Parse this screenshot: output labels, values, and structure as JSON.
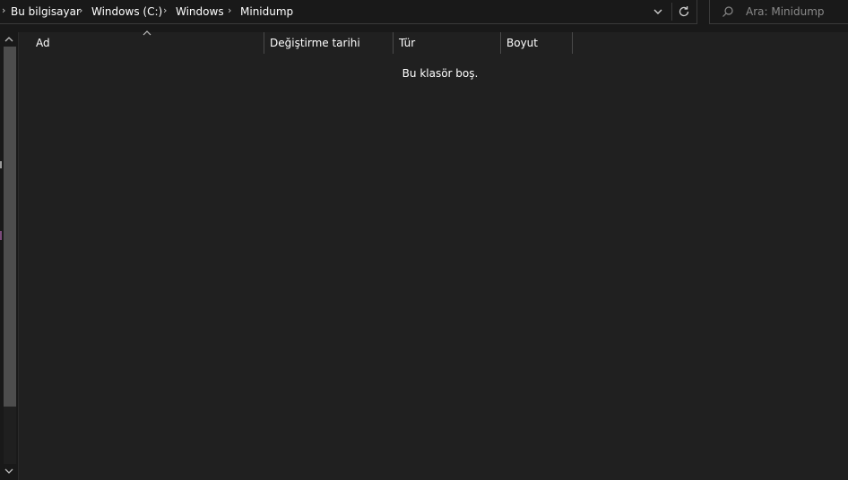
{
  "breadcrumb": {
    "items": [
      {
        "label": "Bu bilgisayar"
      },
      {
        "label": "Windows (C:)"
      },
      {
        "label": "Windows"
      },
      {
        "label": "Minidump"
      }
    ],
    "dropdown_icon": "chevron-down-icon",
    "refresh_icon": "refresh-icon"
  },
  "search": {
    "placeholder": "Ara: Minidump",
    "icon": "search-icon"
  },
  "columns": [
    {
      "label": "Ad"
    },
    {
      "label": "Değiştirme tarihi"
    },
    {
      "label": "Tür"
    },
    {
      "label": "Boyut"
    }
  ],
  "content": {
    "empty_message": "Bu klasör boş."
  },
  "colors": {
    "background": "#191919",
    "content_background": "#202020",
    "border": "#3a3a3a",
    "text": "#ffffff",
    "placeholder": "#8a8a8a"
  }
}
